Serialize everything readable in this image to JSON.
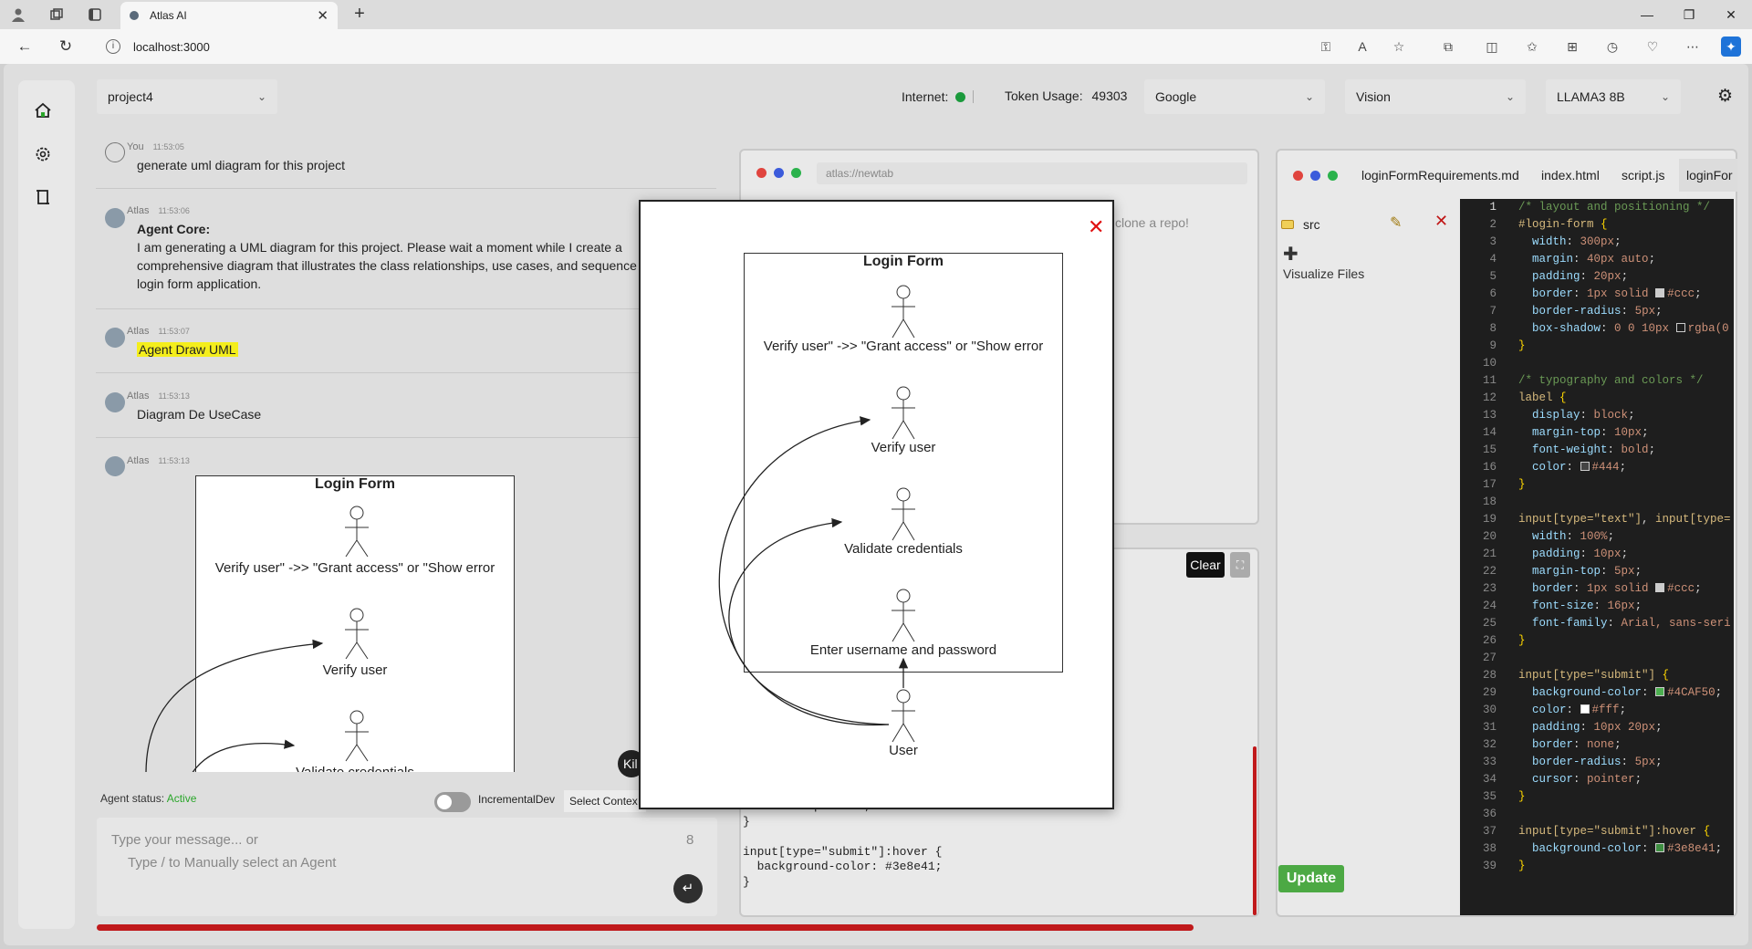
{
  "browser": {
    "tab_title": "Atlas AI",
    "url": "localhost:3000"
  },
  "header": {
    "project": "project4",
    "internet_label": "Internet:",
    "token_label": "Token Usage:",
    "token_value": "49303",
    "provider": "Google",
    "mode": "Vision",
    "model": "LLAMA3 8B"
  },
  "chat": {
    "messages": [
      {
        "who": "You",
        "time": "11:53:05",
        "text": "generate uml diagram for this project"
      },
      {
        "who": "Atlas",
        "time": "11:53:06",
        "title": "Agent Core:",
        "text": "I am generating a UML diagram for this project. Please wait a moment while I create a comprehensive diagram that illustrates the class relationships, use cases, and sequence for the login form application."
      },
      {
        "who": "Atlas",
        "time": "11:53:07",
        "text": "Agent Draw UML"
      },
      {
        "who": "Atlas",
        "time": "11:53:13",
        "text": "Diagram De UseCase"
      },
      {
        "who": "Atlas",
        "time": "11:53:13"
      }
    ],
    "kill_label": "Kil",
    "agent_status_label": "Agent status:",
    "agent_status_value": "Active",
    "incremental_label": "IncrementalDev",
    "select_context": "Select Contex",
    "input_placeholder_1": "Type your message...   or",
    "input_placeholder_2": "Type /  to Manually select an Agent",
    "char_count": "8"
  },
  "uml": {
    "title": "Login Form",
    "actors": [
      "Verify user\" ->> \"Grant access\" or \"Show error",
      "Verify user",
      "Validate credentials",
      "Enter username and password"
    ],
    "user": "User"
  },
  "browser_panel": {
    "address": "atlas://newtab",
    "hint": "clone a repo!"
  },
  "terminal": {
    "clear_label": "Clear",
    "code": "  cursor: pointer;\n}\n\ninput[type=\"submit\"]:hover {\n  background-color: #3e8e41;\n}"
  },
  "files": {
    "tabs": [
      "loginFormRequirements.md",
      "index.html",
      "script.js",
      "loginFor"
    ],
    "folder": "src",
    "visualize_label": "Visualize Files",
    "update_label": "Update"
  },
  "colors": {
    "accent_red": "#c0191b",
    "status_green": "#1b9a3c",
    "update_green": "#4ca944",
    "editor_bg": "#1e1e1e"
  }
}
